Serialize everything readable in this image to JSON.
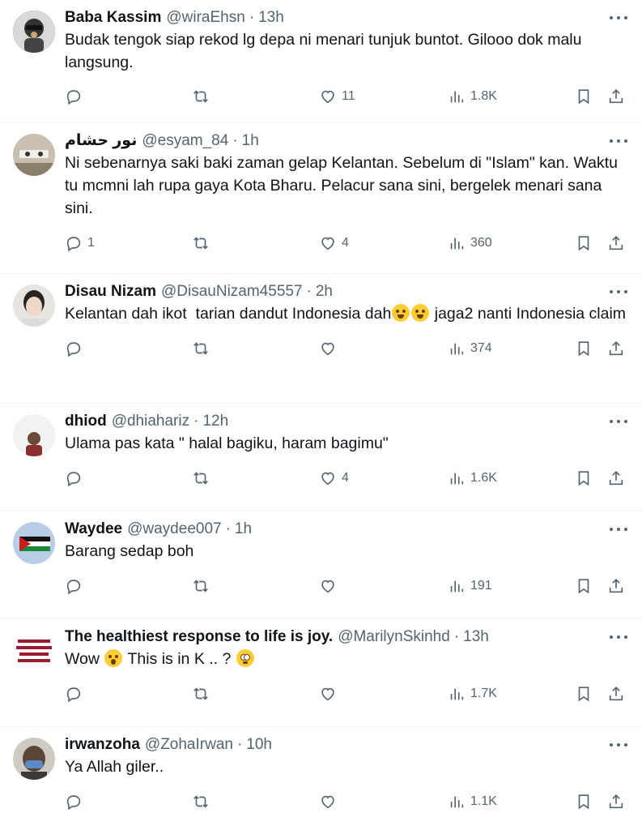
{
  "tweets": [
    {
      "name": "Baba Kassim",
      "handle": "@wiraEhsn",
      "time": "13h",
      "text": "Budak tengok siap rekod lg depa ni menari tunjuk buntot. Gilooo dok malu langsung.",
      "replies": "",
      "retweets": "",
      "likes": "11",
      "views": "1.8K"
    },
    {
      "name": "نور حشام",
      "handle": "@esyam_84",
      "time": "1h",
      "text": "Ni sebenarnya saki baki zaman gelap Kelantan. Sebelum di \"Islam\" kan. Waktu tu mcmni lah rupa gaya Kota Bharu. Pelacur sana sini, bergelek menari sana sini.",
      "replies": "1",
      "retweets": "",
      "likes": "4",
      "views": "360"
    },
    {
      "name": "Disau Nizam",
      "handle": "@DisauNizam45557",
      "time": "2h",
      "text_before": "Kelantan dah ikot  tarian dandut Indonesia dah",
      "text_after": " jaga2 nanti Indonesia claim",
      "replies": "",
      "retweets": "",
      "likes": "",
      "views": "374"
    },
    {
      "name": "dhiod",
      "handle": "@dhiahariz",
      "time": "12h",
      "text": "Ulama pas kata \" halal bagiku, haram bagimu\"",
      "replies": "",
      "retweets": "",
      "likes": "4",
      "views": "1.6K"
    },
    {
      "name": "Waydee",
      "handle": "@waydee007",
      "time": "1h",
      "text": "Barang sedap boh",
      "replies": "",
      "retweets": "",
      "likes": "",
      "views": "191"
    },
    {
      "name": "The healthiest response to life is joy.",
      "handle": "@MarilynSkinhd",
      "time": "13h",
      "text_before": "Wow ",
      "text_middle": " This is in K .. ? ",
      "replies": "",
      "retweets": "",
      "likes": "",
      "views": "1.7K"
    },
    {
      "name": "irwanzoha",
      "handle": "@ZohaIrwan",
      "time": "10h",
      "text": "Ya Allah giler..",
      "replies": "",
      "retweets": "",
      "likes": "",
      "views": "1.1K"
    }
  ],
  "icons": {
    "reply": "reply-icon",
    "retweet": "retweet-icon",
    "like": "heart-icon",
    "views": "views-icon",
    "bookmark": "bookmark-icon",
    "share": "share-icon",
    "more": "more-icon"
  },
  "colors": {
    "text": "#0f1419",
    "secondary": "#536471",
    "divider": "#eff3f4"
  }
}
